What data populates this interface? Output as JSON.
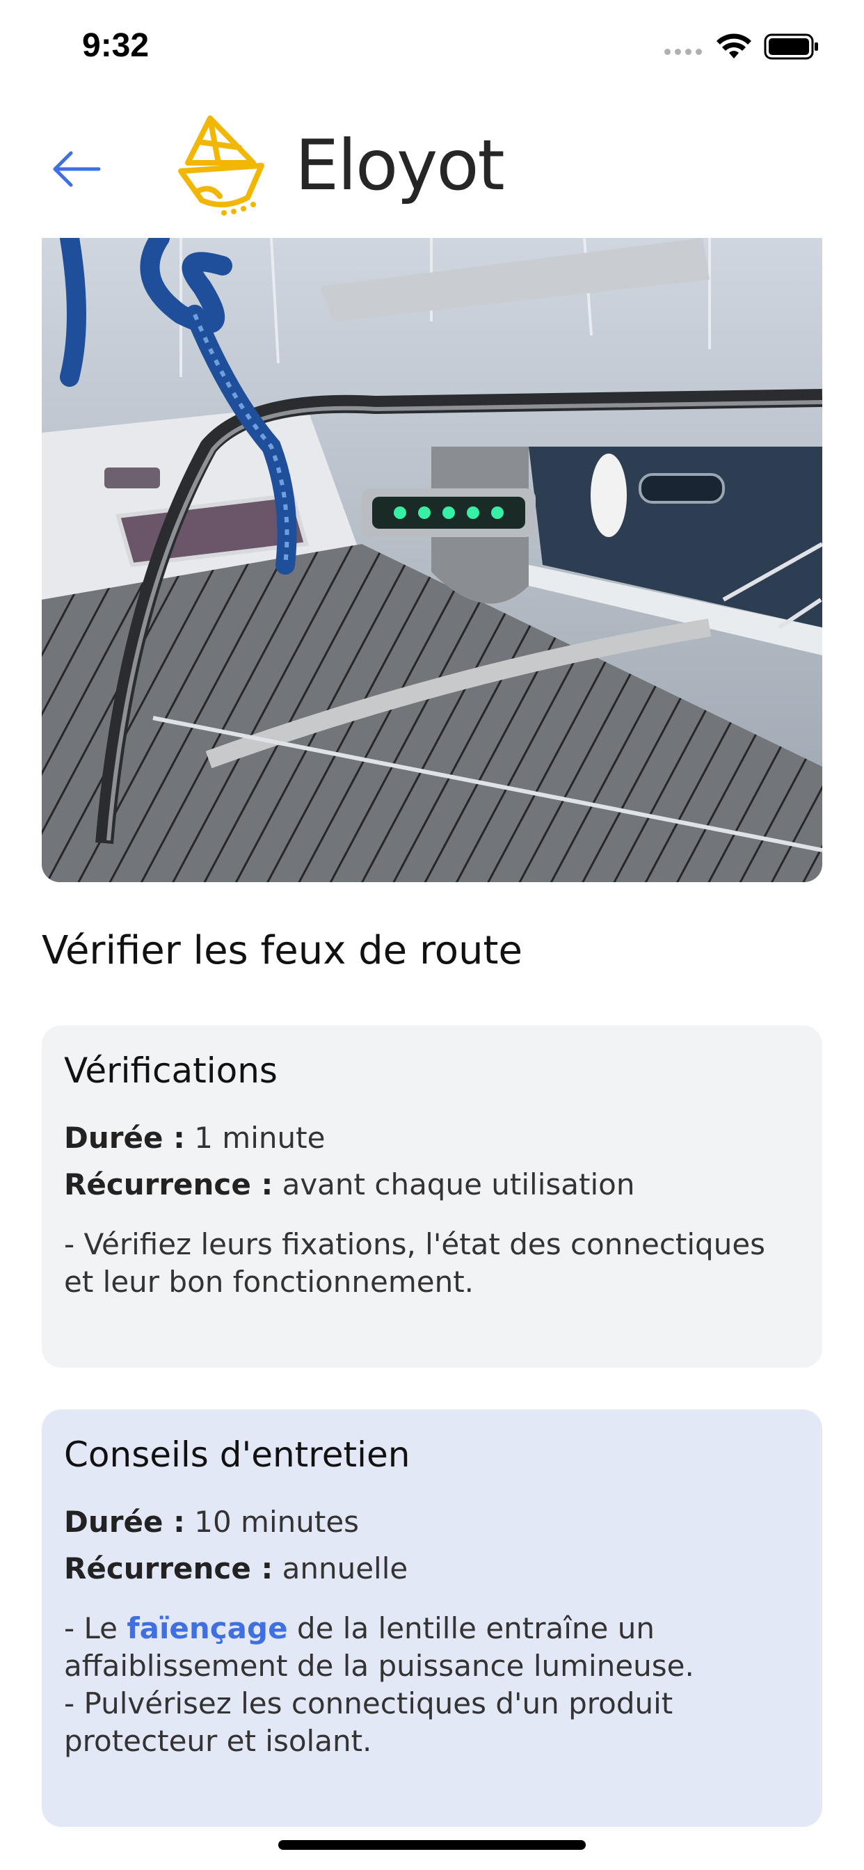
{
  "status_bar": {
    "time": "9:32"
  },
  "header": {
    "app_name": "Eloyot"
  },
  "task": {
    "title": "Vérifier les feux de route"
  },
  "verifications": {
    "heading": "Vérifications",
    "duration_label": "Durée :",
    "duration_value": "1 minute",
    "recurrence_label": "Récurrence :",
    "recurrence_value": "avant chaque utilisation",
    "text": "- Vérifiez leurs fixations, l'état des connectiques et leur bon fonctionnement."
  },
  "maintenance": {
    "heading": "Conseils d'entretien",
    "duration_label": "Durée :",
    "duration_value": "10 minutes",
    "recurrence_label": "Récurrence :",
    "recurrence_value": "annuelle",
    "text_prefix": "- Le",
    "link_term": "faïençage",
    "text_suffix": "de la lentille entraîne un affaiblissement de la puissance lumineuse.",
    "text_line2": "- Pulvérisez les connectiques d'un produit protecteur et isolant."
  },
  "colors": {
    "accent": "#3f6fe0",
    "logo": "#f2b705",
    "card_verif": "#f2f3f5",
    "card_tips": "#e3e8f7"
  },
  "icons": [
    "back-arrow-icon",
    "sailboat-logo-icon",
    "wifi-icon",
    "battery-icon"
  ]
}
